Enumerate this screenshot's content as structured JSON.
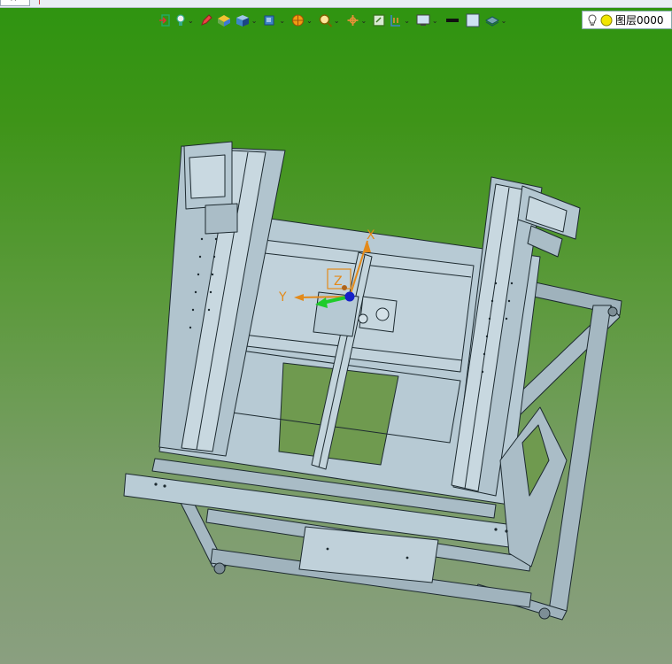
{
  "tab": {
    "close_glyph": "×"
  },
  "toolbar": {
    "items": [
      {
        "icon": "exit-sketch-icon",
        "dropdown": false
      },
      {
        "icon": "light-bulb-icon",
        "dropdown": true
      },
      {
        "icon": "pen-icon",
        "dropdown": false
      },
      {
        "icon": "box-solid-icon",
        "dropdown": false
      },
      {
        "icon": "cube-blue-icon",
        "dropdown": true
      },
      {
        "icon": "view-cube-icon",
        "dropdown": true
      },
      {
        "icon": "basketball-render-icon",
        "dropdown": true
      },
      {
        "icon": "zoom-icon",
        "dropdown": true
      },
      {
        "icon": "orient-axis-icon",
        "dropdown": true
      },
      {
        "icon": "sketch-frame-icon",
        "dropdown": false
      },
      {
        "icon": "section-view-icon",
        "dropdown": true
      },
      {
        "icon": "display-settings-icon",
        "dropdown": true
      },
      {
        "icon": "line-color-icon",
        "dropdown": false
      },
      {
        "icon": "fill-color-icon",
        "dropdown": false
      },
      {
        "icon": "layer-stack-icon",
        "dropdown": true
      }
    ]
  },
  "layer": {
    "label": "图层0000",
    "color": "#f2e600"
  },
  "triad": {
    "x_label": "X",
    "y_label": "Y",
    "z_label": "Z"
  },
  "colors": {
    "accent": "#e38a1a",
    "part": "#b9ccd6",
    "edge": "#1d2a30"
  }
}
